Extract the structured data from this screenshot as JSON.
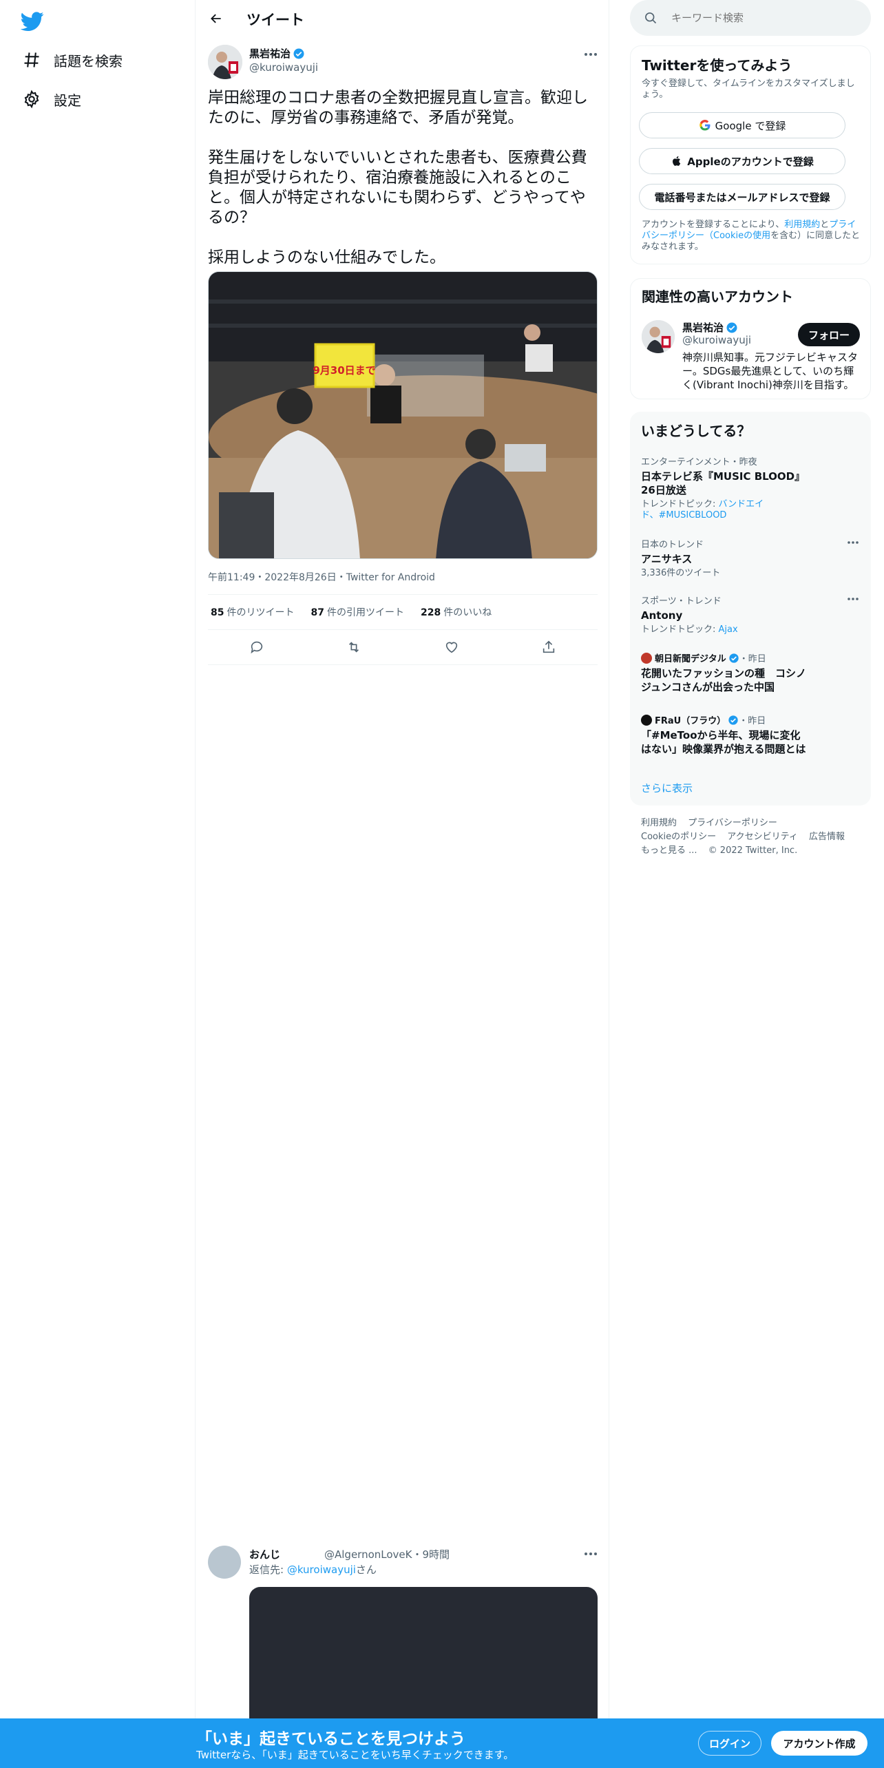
{
  "nav": {
    "items": [
      {
        "label": "話題を検索",
        "icon": "hashtag-icon"
      },
      {
        "label": "設定",
        "icon": "gear-icon"
      }
    ]
  },
  "header": {
    "title": "ツイート"
  },
  "tweet": {
    "author_name": "黒岩祐治",
    "author_handle": "@kuroiwayuji",
    "text": "岸田総理のコロナ患者の全数把握見直し宣言。歓迎したのに、厚労省の事務連絡で、矛盾が発覚。\n\n発生届けをしないでいいとされた患者も、医療費公費負担が受けられたり、宿泊療養施設に入れるとのこと。個人が特定されないにも関わらず、どうやってやるの？\n\n採用しようのない仕組みでした。",
    "photo_sign_top": "9月30日まで",
    "meta_time": "午前11:49",
    "meta_date": "2022年8月26日",
    "meta_source": "Twitter for Android",
    "stats": [
      {
        "count": "85",
        "label": "件のリツイート"
      },
      {
        "count": "87",
        "label": "件の引用ツイート"
      },
      {
        "count": "228",
        "label": "件のいいね"
      }
    ]
  },
  "reply": {
    "name": "おんじ",
    "handle_time": "@AlgernonLoveK・9時間",
    "reply_prefix": "返信先: ",
    "reply_to": "@kuroiwayuji",
    "reply_suffix": "さん"
  },
  "search": {
    "placeholder": "キーワード検索"
  },
  "signup": {
    "title": "Twitterを使ってみよう",
    "subtitle": "今すぐ登録して、タイムラインをカスタマイズしましょう。",
    "google": "Google で登録",
    "apple": "Appleのアカウントで登録",
    "phone": "電話番号またはメールアドレスで登録",
    "terms_1": "アカウントを登録することにより、",
    "terms_link1": "利用規約",
    "terms_2": "と",
    "terms_link2": "プライバシーポリシー（Cookieの使用",
    "terms_3": "を含む）に同意したとみなされます。"
  },
  "related": {
    "title": "関連性の高いアカウント",
    "name": "黒岩祐治",
    "handle": "@kuroiwayuji",
    "follow": "フォロー",
    "bio": "神奈川県知事。元フジテレビキャスター。SDGs最先進県として、いのち輝く(Vibrant Inochi)神奈川を目指す。"
  },
  "trends": {
    "title": "いまどうしてる？",
    "items": [
      {
        "category": "エンターテインメント・昨夜",
        "name": "日本テレビ系『MUSIC BLOOD』 26日放送",
        "sub_prefix": "トレンドトピック: ",
        "sub_link": "バンドエイド、#MUSICBLOOD"
      },
      {
        "category": "日本のトレンド",
        "name": "アニサキス",
        "sub": "3,336件のツイート"
      },
      {
        "category": "スポーツ・トレンド",
        "name": "Antony",
        "sub_prefix": "トレンドトピック: ",
        "sub_link": "Ajax"
      },
      {
        "source": "朝日新聞デジタル",
        "time": "・昨日",
        "name": "花開いたファッションの種　コシノジュンコさんが出会った中国"
      },
      {
        "source": "FRaU（フラウ）",
        "time": "・昨日",
        "name": "「#MeTooから半年、現場に変化はない」映像業界が抱える問題とは"
      }
    ],
    "show_more": "さらに表示"
  },
  "footer": {
    "links": [
      "利用規約",
      "プライバシーポリシー",
      "Cookieのポリシー",
      "アクセシビリティ",
      "広告情報",
      "もっと見る ..."
    ],
    "copyright": "© 2022 Twitter, Inc."
  },
  "bottom_bar": {
    "title": "「いま」起きていることを見つけよう",
    "subtitle": "Twitterなら、「いま」起きていることをいち早くチェックできます。",
    "login": "ログイン",
    "signup": "アカウント作成"
  },
  "colors": {
    "accent": "#1d9bf0",
    "text": "#0f1419",
    "muted": "#536471",
    "border": "#eff3f4"
  }
}
